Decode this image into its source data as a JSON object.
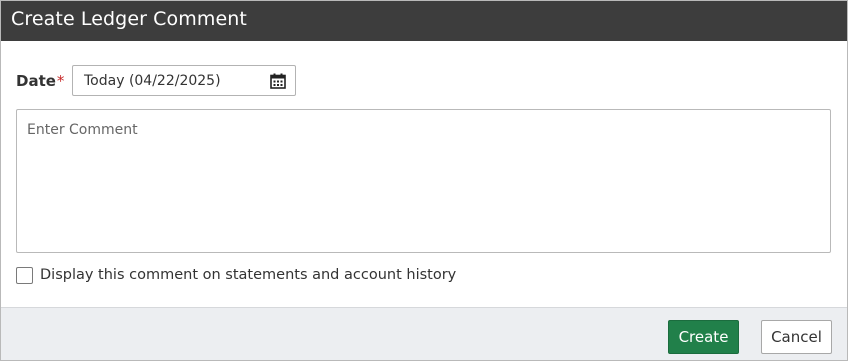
{
  "dialog": {
    "title": "Create Ledger Comment"
  },
  "date": {
    "label": "Date",
    "required_marker": "*",
    "value": "Today (04/22/2025)",
    "icon": "calendar-icon"
  },
  "comment": {
    "placeholder": "Enter Comment",
    "value": ""
  },
  "display_option": {
    "label": "Display this comment on statements and account history",
    "checked": false
  },
  "footer": {
    "create_label": "Create",
    "cancel_label": "Cancel"
  },
  "colors": {
    "titlebar": "#3d3d3d",
    "primary_button": "#21804a",
    "required": "#c62828",
    "footer_bg": "#eceef1"
  }
}
